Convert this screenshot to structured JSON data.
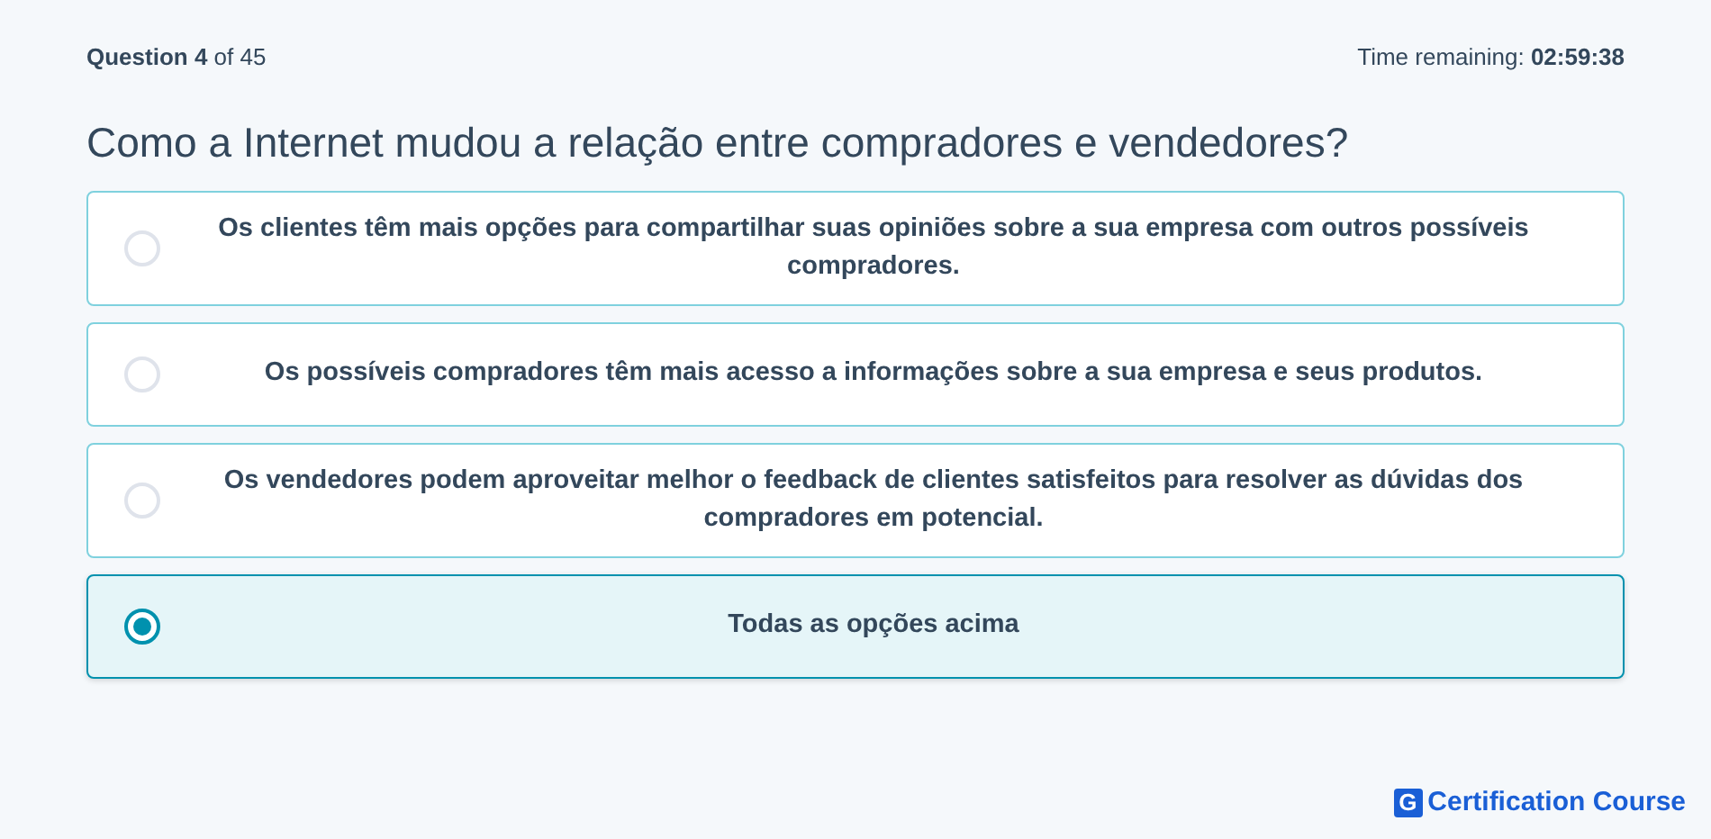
{
  "progress": "**Question 4** of 45",
  "timer": "Time remaining: **02:59:38**",
  "question": "Como a Internet mudou a relação entre compradores e vendedores?",
  "options": [
    {
      "label": "Os clientes têm mais opções para compartilhar suas opiniões sobre a sua empresa com outros possíveis compradores.",
      "selected": false
    },
    {
      "label": "Os possíveis compradores têm mais acesso a informações sobre a sua empresa e seus produtos.",
      "selected": false
    },
    {
      "label": "Os vendedores podem aproveitar melhor o feedback de clientes satisfeitos para resolver as dúvidas dos compradores em potencial.",
      "selected": false
    },
    {
      "label": "Todas as opções acima",
      "selected": true
    }
  ],
  "brand": {
    "mark": "G",
    "name": "Certification Course"
  }
}
